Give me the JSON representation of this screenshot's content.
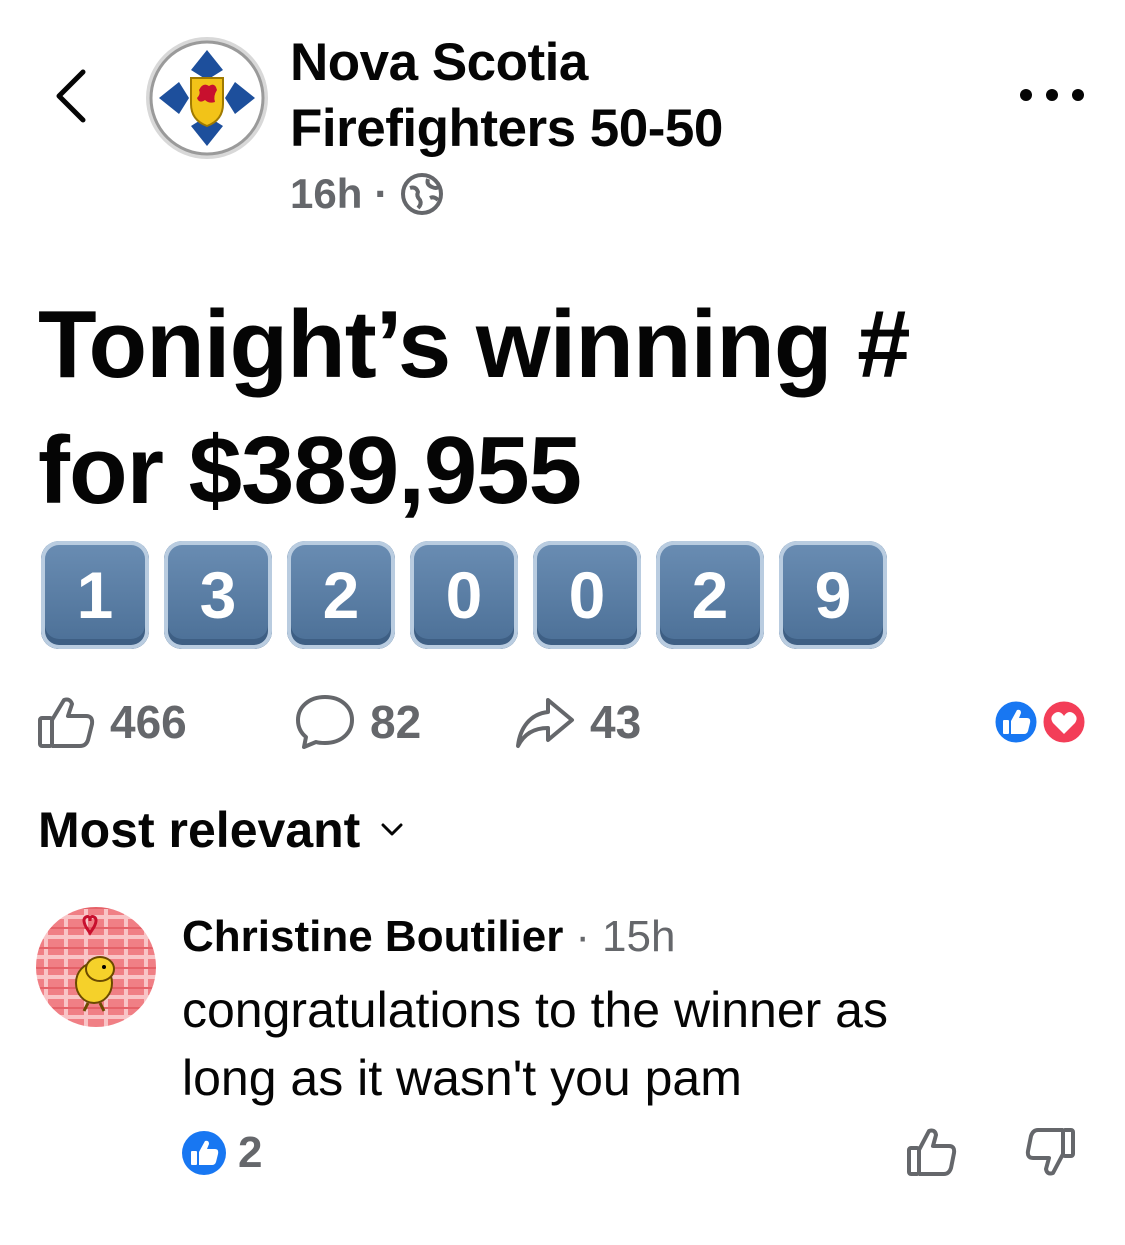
{
  "post": {
    "page_name_line1": "Nova Scotia",
    "page_name_line2": "Firefighters 50-50",
    "time": "16h",
    "separator": "·",
    "audience_icon": "globe-icon",
    "text_line1": "Tonight’s winning #",
    "text_line2": "for $389,955",
    "digits": [
      "1",
      "3",
      "2",
      "0",
      "0",
      "2",
      "9"
    ]
  },
  "stats": {
    "likes": "466",
    "comments": "82",
    "shares": "43",
    "reaction_icons": [
      "like-reaction-icon",
      "love-reaction-icon"
    ]
  },
  "sort": {
    "label": "Most relevant"
  },
  "comment": {
    "author": "Christine Boutilier",
    "separator": "·",
    "time": "15h",
    "body_line1": "congratulations to the winner as",
    "body_line2": "long as it wasn't you pam",
    "reaction_count": "2"
  },
  "colors": {
    "text_primary": "#050505",
    "text_secondary": "#65676b",
    "like_blue": "#1877f2",
    "love_red": "#f33e58",
    "keycap_blue": "#5a7ea5"
  }
}
